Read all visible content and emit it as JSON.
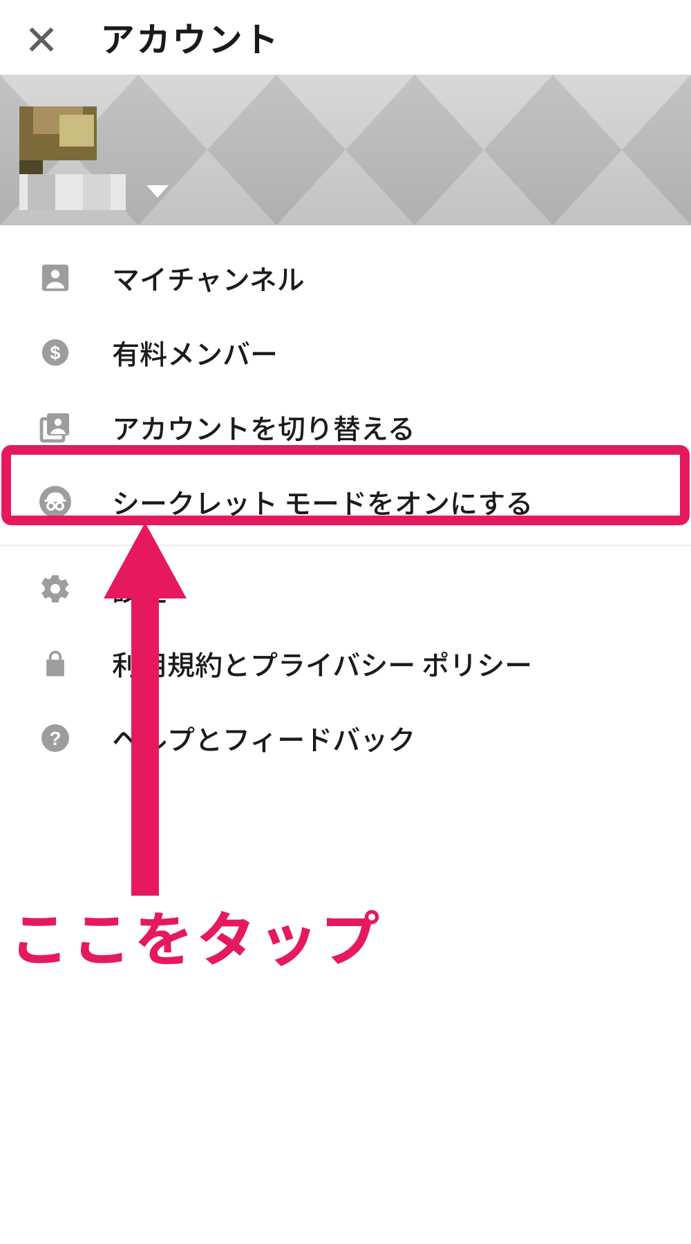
{
  "header": {
    "title": "アカウント"
  },
  "menu": {
    "my_channel": "マイチャンネル",
    "paid_member": "有料メンバー",
    "switch_account": "アカウントを切り替える",
    "incognito_on": "シークレット モードをオンにする",
    "settings": "設定",
    "terms_privacy": "利用規約とプライバシー ポリシー",
    "help_feedback": "ヘルプとフィードバック"
  },
  "annotation": {
    "tap_here": "ここをタップ",
    "highlight_color": "#e6195d"
  }
}
